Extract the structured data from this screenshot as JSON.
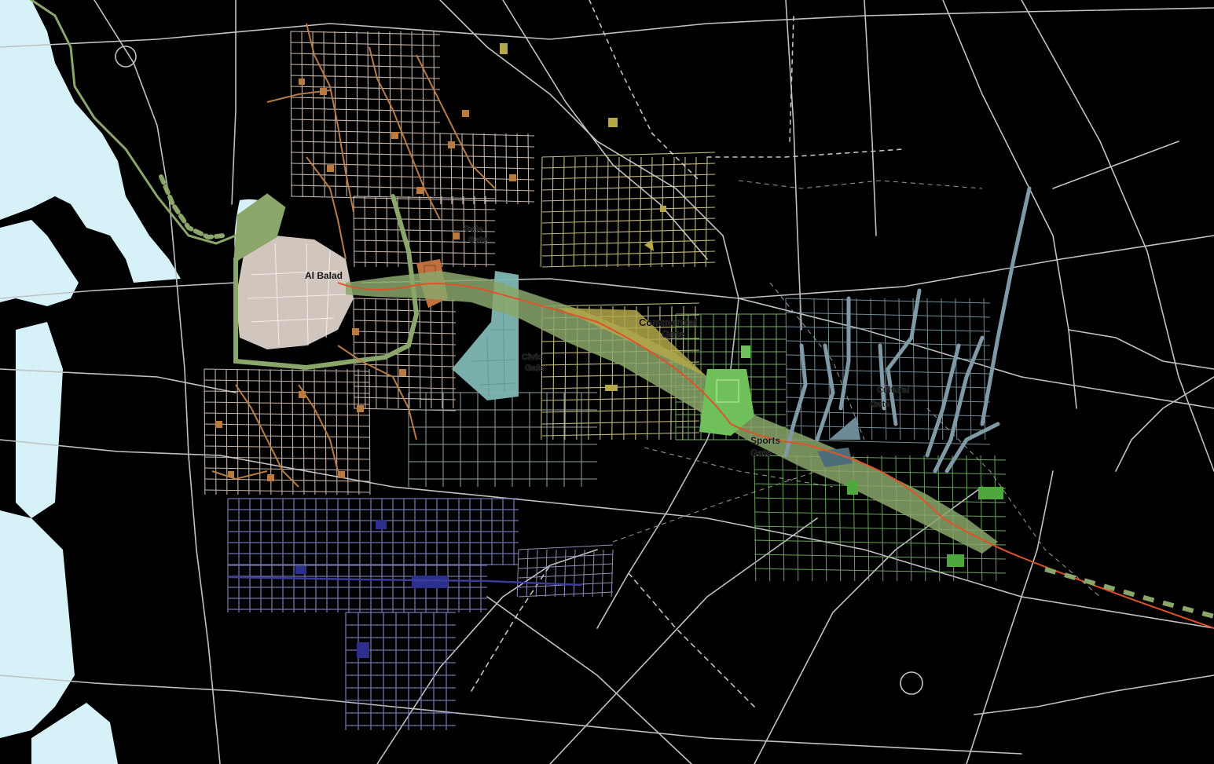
{
  "labels": {
    "al_balad": "Al Balad",
    "gate_north_1": "Gate",
    "gate_north_2": "Gate",
    "commercial_1": "Commercial",
    "commercial_2": "Gate",
    "civic_1": "Civic",
    "civic_2": "Gate",
    "cultural_1": "Cultural",
    "cultural_2": "Gate",
    "sports_1": "Sports",
    "sports_2": "Gate"
  },
  "colors": {
    "background": "#000000",
    "sea": "#d6f2f8",
    "road": "#bfc3c6",
    "old_town": "#d9c9bd",
    "heritage_brown": "#b87b44",
    "commercial_yellow": "#d6cf92",
    "civic_teal": "#7fb7b3",
    "green_corridor": "#8aa66a",
    "sports_green": "#6fbf5a",
    "grid_purple": "#7d7fb8",
    "purple_dark": "#2d2f8c",
    "cultural_steel": "#7f9aa6",
    "red_line": "#e0522a"
  }
}
